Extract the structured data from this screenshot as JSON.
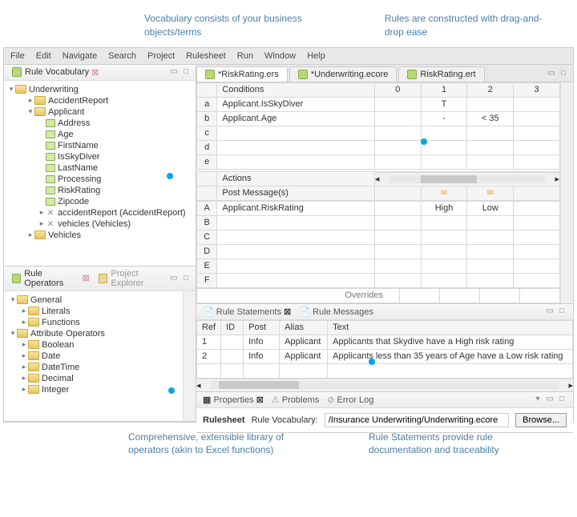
{
  "annotations": {
    "top_left": "Vocabulary consists of your business objects/terms",
    "top_right": "Rules are constructed with drag-and-drop ease",
    "bottom_left": "Comprehensive, extensible library of operators (akin to Excel functions)",
    "bottom_right": "Rule Statements provide rule documentation and traceability"
  },
  "menubar": [
    "File",
    "Edit",
    "Navigate",
    "Search",
    "Project",
    "Rulesheet",
    "Run",
    "Window",
    "Help"
  ],
  "vocab_panel": {
    "title": "Rule Vocabulary",
    "root": "Underwriting",
    "items": [
      {
        "level": 1,
        "caret": "▸",
        "icon": "folder",
        "label": "AccidentReport"
      },
      {
        "level": 1,
        "caret": "▾",
        "icon": "folder",
        "label": "Applicant"
      },
      {
        "level": 2,
        "caret": "",
        "icon": "attr",
        "label": "Address"
      },
      {
        "level": 2,
        "caret": "",
        "icon": "attr",
        "label": "Age"
      },
      {
        "level": 2,
        "caret": "",
        "icon": "attr",
        "label": "FirstName"
      },
      {
        "level": 2,
        "caret": "",
        "icon": "attr",
        "label": "IsSkyDiver"
      },
      {
        "level": 2,
        "caret": "",
        "icon": "attr",
        "label": "LastName"
      },
      {
        "level": 2,
        "caret": "",
        "icon": "attr",
        "label": "Processing"
      },
      {
        "level": 2,
        "caret": "",
        "icon": "attr",
        "label": "RiskRating"
      },
      {
        "level": 2,
        "caret": "",
        "icon": "attr",
        "label": "Zipcode"
      },
      {
        "level": 2,
        "caret": "▸",
        "icon": "rel",
        "label": "accidentReport (AccidentReport)"
      },
      {
        "level": 2,
        "caret": "▸",
        "icon": "rel",
        "label": "vehicles (Vehicles)"
      },
      {
        "level": 1,
        "caret": "▸",
        "icon": "folder",
        "label": "Vehicles"
      }
    ]
  },
  "operators_panel": {
    "title": "Rule Operators",
    "alt_title": "Project Explorer",
    "items": [
      {
        "level": 0,
        "caret": "▾",
        "icon": "folder",
        "label": "General"
      },
      {
        "level": 1,
        "caret": "▸",
        "icon": "folder",
        "label": "Literals"
      },
      {
        "level": 1,
        "caret": "▸",
        "icon": "folder",
        "label": "Functions"
      },
      {
        "level": 0,
        "caret": "▾",
        "icon": "folder",
        "label": "Attribute Operators"
      },
      {
        "level": 1,
        "caret": "▸",
        "icon": "folder",
        "label": "Boolean"
      },
      {
        "level": 1,
        "caret": "▸",
        "icon": "folder",
        "label": "Date"
      },
      {
        "level": 1,
        "caret": "▸",
        "icon": "folder",
        "label": "DateTime"
      },
      {
        "level": 1,
        "caret": "▸",
        "icon": "folder",
        "label": "Decimal"
      },
      {
        "level": 1,
        "caret": "▸",
        "icon": "folder",
        "label": "Integer"
      }
    ]
  },
  "editor": {
    "tabs": [
      {
        "label": "*RiskRating.ers",
        "active": true
      },
      {
        "label": "*Underwriting.ecore",
        "active": false
      },
      {
        "label": "RiskRating.ert",
        "active": false
      }
    ],
    "conditions_header": "Conditions",
    "cols": [
      "0",
      "1",
      "2",
      "3"
    ],
    "condition_rows": [
      {
        "id": "a",
        "label": "Applicant.IsSkyDiver",
        "cells": [
          "",
          "T",
          "",
          ""
        ]
      },
      {
        "id": "b",
        "label": "Applicant.Age",
        "cells": [
          "",
          "-",
          "< 35",
          ""
        ]
      },
      {
        "id": "c",
        "label": "",
        "cells": [
          "",
          "",
          "",
          ""
        ]
      },
      {
        "id": "d",
        "label": "",
        "cells": [
          "",
          "",
          "",
          ""
        ]
      },
      {
        "id": "e",
        "label": "",
        "cells": [
          "",
          "",
          "",
          ""
        ]
      }
    ],
    "actions_header": "Actions",
    "post_header": "Post Message(s)",
    "action_rows": [
      {
        "id": "A",
        "label": "Applicant.RiskRating",
        "cells": [
          "",
          "High",
          "Low",
          ""
        ]
      },
      {
        "id": "B",
        "label": "",
        "cells": [
          "",
          "",
          "",
          ""
        ]
      },
      {
        "id": "C",
        "label": "",
        "cells": [
          "",
          "",
          "",
          ""
        ]
      },
      {
        "id": "D",
        "label": "",
        "cells": [
          "",
          "",
          "",
          ""
        ]
      },
      {
        "id": "E",
        "label": "",
        "cells": [
          "",
          "",
          "",
          ""
        ]
      },
      {
        "id": "F",
        "label": "",
        "cells": [
          "",
          "",
          "",
          ""
        ]
      }
    ],
    "overrides": "Overrides"
  },
  "statements": {
    "title": "Rule Statements",
    "alt_title": "Rule Messages",
    "headers": [
      "Ref",
      "ID",
      "Post",
      "Alias",
      "Text"
    ],
    "rows": [
      {
        "ref": "1",
        "id": "",
        "post": "Info",
        "alias": "Applicant",
        "text": "Applicants that Skydive have a High risk rating"
      },
      {
        "ref": "2",
        "id": "",
        "post": "Info",
        "alias": "Applicant",
        "text": "Applicants less than 35 years of Age have a Low risk rating"
      }
    ]
  },
  "properties": {
    "tabs": [
      "Properties",
      "Problems",
      "Error Log"
    ],
    "label": "Rulesheet",
    "field_label": "Rule Vocabulary:",
    "value": "/Insurance Underwriting/Underwriting.ecore",
    "browse": "Browse..."
  }
}
